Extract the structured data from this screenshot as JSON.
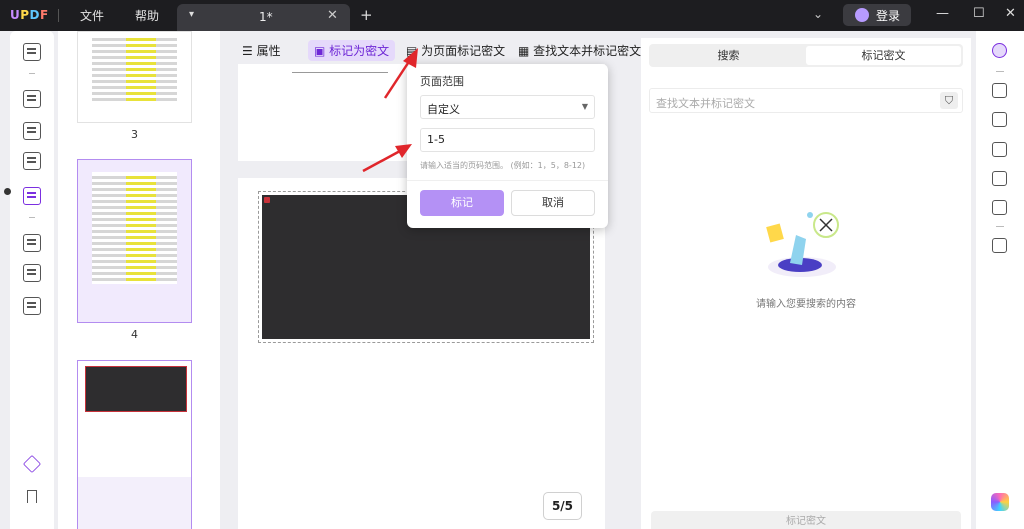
{
  "titlebar": {
    "logo": {
      "u": "U",
      "p": "P",
      "d": "D",
      "f": "F"
    },
    "menu_file": "文件",
    "menu_help": "帮助",
    "tab_title": "1*",
    "tab_chevron": "▾",
    "tab_close": "✕",
    "tab_add": "+",
    "dropdown_chevron": "⌄",
    "login_label": "登录",
    "minimize": "—",
    "maximize": "☐",
    "close": "✕"
  },
  "thumbnails": [
    {
      "number": "3"
    },
    {
      "number": "4"
    }
  ],
  "toolbar": {
    "properties_label": "属性",
    "mark_redaction_label": "标记为密文",
    "mark_page_label": "为页面标记密文",
    "find_mark_label": "查找文本并标记密文"
  },
  "popup": {
    "title": "页面范围",
    "select_value": "自定义",
    "caret": "▼",
    "range_value": "1-5",
    "hint": "请输入适当的页码范围。 (例如：1，5，8-12)",
    "mark_button": "标记",
    "cancel_button": "取消"
  },
  "page_indicator": "5/5",
  "right_panel": {
    "tab_search": "搜索",
    "tab_redact": "标记密文",
    "search_placeholder": "查找文本并标记密文",
    "filter_glyph": "⛉",
    "empty_text": "请输入您要搜索的内容",
    "bottom_button": "标记密文"
  },
  "colors": {
    "accent": "#7b2fe0",
    "accent_light": "#e5d9fb",
    "arrow": "#e0262b",
    "redaction_fill": "#2e2d2f"
  }
}
